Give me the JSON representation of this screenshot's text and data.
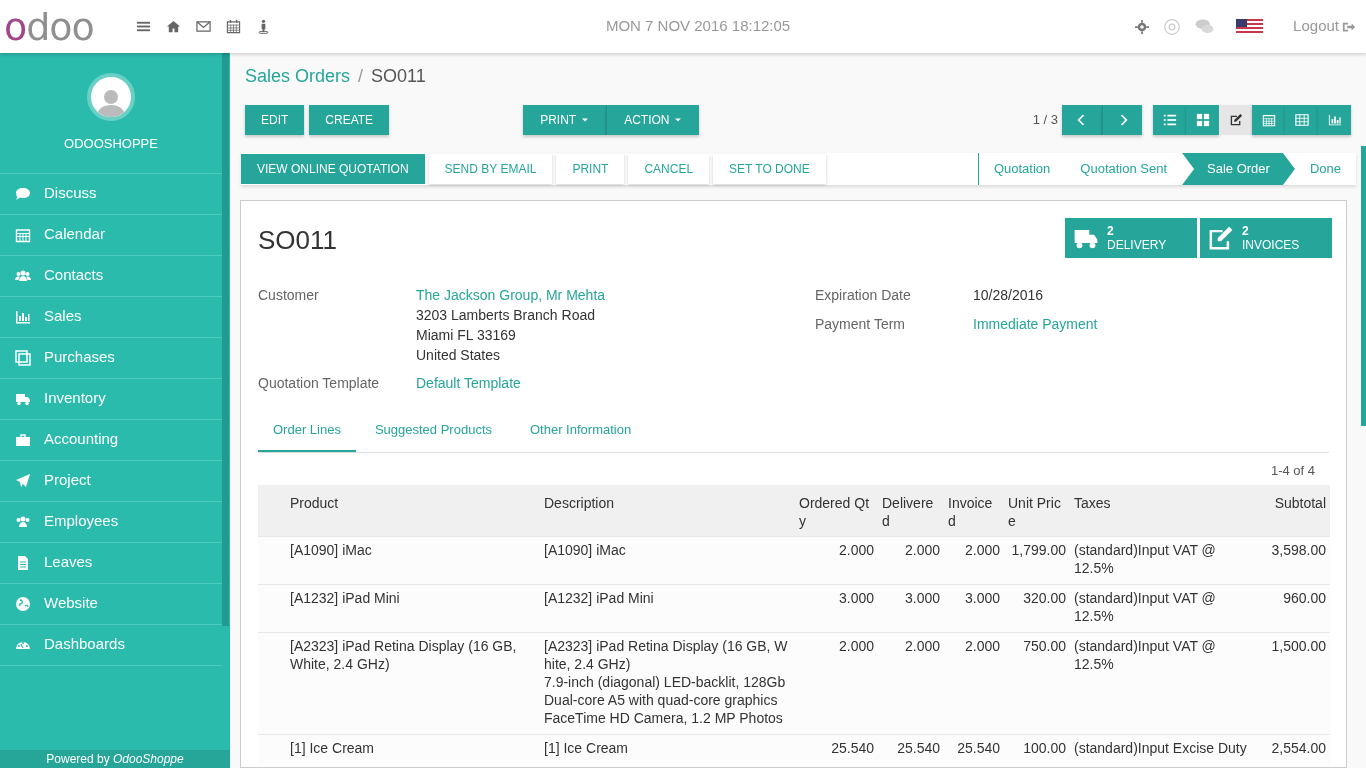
{
  "topbar": {
    "logo": "odoo",
    "datetime": "MON 7 NOV 2016 18:12:05",
    "logout": "Logout"
  },
  "sidebar": {
    "company": "ODOOSHOPPE",
    "items": [
      {
        "label": "Discuss",
        "selected": false
      },
      {
        "label": "Calendar",
        "selected": false
      },
      {
        "label": "Contacts",
        "selected": false
      },
      {
        "label": "Sales",
        "selected": false
      },
      {
        "label": "Purchases",
        "selected": false
      },
      {
        "label": "Inventory",
        "selected": false
      },
      {
        "label": "Accounting",
        "selected": false
      },
      {
        "label": "Project",
        "selected": false
      },
      {
        "label": "Employees",
        "selected": false
      },
      {
        "label": "Leaves",
        "selected": false
      },
      {
        "label": "Website",
        "selected": false
      },
      {
        "label": "Dashboards",
        "selected": false
      }
    ],
    "footer": "Powered by *OdooShoppe*"
  },
  "breadcrumb": {
    "parent": "Sales Orders",
    "separator": "/",
    "current": "SO011"
  },
  "buttons": [
    "EDIT",
    "CREATE"
  ],
  "dropdowns": [
    "PRINT",
    "ACTION"
  ],
  "pager": "1 / 3",
  "views": [
    {
      "selected": false
    },
    {
      "selected": false
    },
    {
      "selected": true
    },
    {
      "selected": false
    },
    {
      "selected": false
    },
    {
      "selected": false
    }
  ],
  "actions": [
    {
      "label": "VIEW ONLINE QUOTATION",
      "primary": true
    },
    {
      "label": "SEND BY EMAIL",
      "primary": false
    },
    {
      "label": "PRINT",
      "primary": false
    },
    {
      "label": "CANCEL",
      "primary": false
    },
    {
      "label": "SET TO DONE",
      "primary": false
    }
  ],
  "stages": [
    {
      "label": "Quotation",
      "selected": false
    },
    {
      "label": "Quotation Sent",
      "selected": false
    },
    {
      "label": "Sale Order",
      "selected": true
    },
    {
      "label": "Done",
      "selected": false
    }
  ],
  "form": {
    "title": "SO011",
    "smart_buttons": [
      {
        "count": "2",
        "label": "DELIVERY"
      },
      {
        "count": "2",
        "label": "INVOICES"
      }
    ],
    "customer": {
      "label": "Customer",
      "name": "The Jackson Group, Mr Mehta",
      "address": [
        "3203 Lamberts Branch Road",
        "Miami FL 33169",
        "United States"
      ]
    },
    "template": {
      "label": "Quotation Template",
      "value": "Default Template"
    },
    "expiration": {
      "label": "Expiration Date",
      "value": "10/28/2016"
    },
    "payment": {
      "label": "Payment Term",
      "value": "Immediate Payment"
    },
    "tabs": [
      {
        "label": "Order Lines",
        "selected": true
      },
      {
        "label": "Suggested Products",
        "selected": false
      },
      {
        "label": "Other Information",
        "selected": false
      }
    ],
    "table": {
      "count": "1-4 of 4",
      "columns": [
        "Product",
        "Description",
        "Ordered Qty",
        "Delivered",
        "Invoiced",
        "Unit Price",
        "Taxes",
        "Subtotal"
      ],
      "rows": [
        [
          "[A1090] iMac",
          [
            "[A1090] iMac"
          ],
          "2.000",
          "2.000",
          "2.000",
          "1,799.00",
          "(standard)Input VAT @ 12.5%",
          "3,598.00"
        ],
        [
          "[A1232] iPad Mini",
          [
            "[A1232] iPad Mini"
          ],
          "3.000",
          "3.000",
          "3.000",
          "320.00",
          "(standard)Input VAT @ 12.5%",
          "960.00"
        ],
        [
          "[A2323] iPad Retina Display (16 GB, White, 2.4 GHz)",
          [
            "[A2323] iPad Retina Display (16 GB, White, 2.4 GHz)",
            "7.9-inch (diagonal) LED-backlit, 128Gb",
            "Dual-core A5 with quad-core graphics",
            "FaceTime HD Camera, 1.2 MP Photos"
          ],
          "2.000",
          "2.000",
          "2.000",
          "750.00",
          "(standard)Input VAT @ 12.5%",
          "1,500.00"
        ],
        [
          "[1] Ice Cream",
          [
            "[1] Ice Cream"
          ],
          "25.540",
          "25.540",
          "25.540",
          "100.00",
          "(standard)Input Excise Duty",
          "2,554.00"
        ]
      ]
    }
  }
}
